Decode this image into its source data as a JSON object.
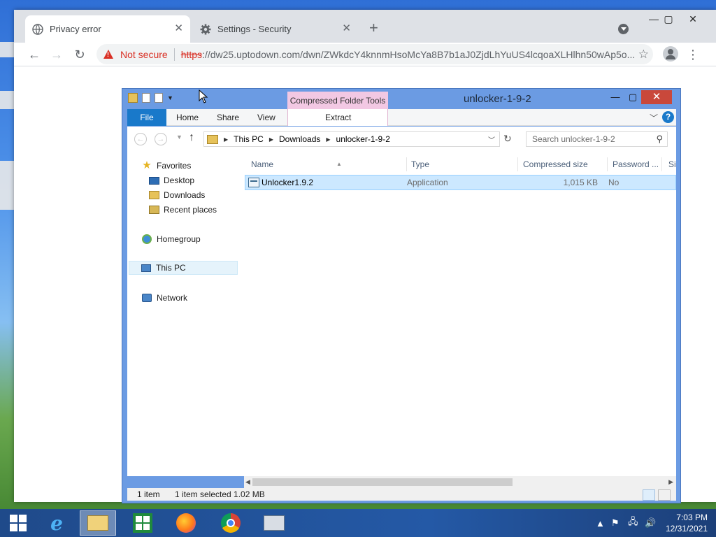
{
  "browser": {
    "tabs": [
      {
        "title": "Privacy error",
        "icon": "globe-icon",
        "active": true
      },
      {
        "title": "Settings - Security",
        "icon": "gear-icon",
        "active": false
      }
    ],
    "new_tab_label": "+",
    "omnibox": {
      "security_label": "Not secure",
      "url_scheme": "https",
      "url_rest": "://dw25.uptodown.com/dwn/ZWkdcY4knnmHsoMcYa8B7b1aJ0ZjdLhYuUS4lcqoaXLHlhn50wAp5o..."
    }
  },
  "explorer": {
    "title": "unlocker-1-9-2",
    "contextual_tab": "Compressed Folder Tools",
    "ribbon_tabs": [
      "File",
      "Home",
      "Share",
      "View"
    ],
    "contextual_subtab": "Extract",
    "breadcrumb": [
      "This PC",
      "Downloads",
      "unlocker-1-9-2"
    ],
    "search_placeholder": "Search unlocker-1-9-2",
    "nav": {
      "favorites": "Favorites",
      "desktop": "Desktop",
      "downloads": "Downloads",
      "recent": "Recent places",
      "homegroup": "Homegroup",
      "thispc": "This PC",
      "network": "Network"
    },
    "columns": [
      "Name",
      "Type",
      "Compressed size",
      "Password ...",
      "Si"
    ],
    "rows": [
      {
        "name": "Unlocker1.9.2",
        "type": "Application",
        "size": "1,015 KB",
        "password": "No"
      }
    ],
    "status": {
      "count": "1 item",
      "selection": "1 item selected  1.02 MB"
    }
  },
  "taskbar": {
    "clock_time": "7:03 PM",
    "clock_date": "12/31/2021"
  },
  "colors": {
    "accent_blue": "#1979ca",
    "contextual_pink": "#f2c8e3",
    "not_secure_red": "#d93025",
    "selection_blue": "#cce8ff"
  }
}
